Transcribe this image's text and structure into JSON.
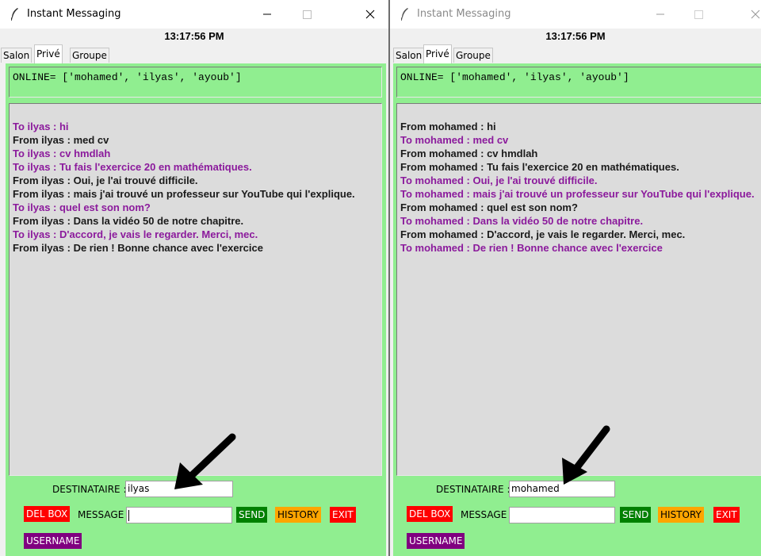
{
  "windows": [
    {
      "title": "Instant Messaging",
      "clock": "13:17:56 PM",
      "tabs": [
        "Salon",
        "Privé",
        "Groupe"
      ],
      "online": "ONLINE= ['mohamed', 'ilyas', 'ayoub']",
      "messages": [
        {
          "dir": "to",
          "text": "To ilyas : hi"
        },
        {
          "dir": "from",
          "text": "From ilyas : med cv"
        },
        {
          "dir": "to",
          "text": "To ilyas : cv hmdlah"
        },
        {
          "dir": "to",
          "text": "To ilyas : Tu fais l'exercice 20 en mathématiques."
        },
        {
          "dir": "from",
          "text": "From ilyas : Oui, je l'ai trouvé difficile."
        },
        {
          "dir": "from",
          "text": "From ilyas : mais j'ai trouvé un professeur sur YouTube qui l'explique."
        },
        {
          "dir": "to",
          "text": "To ilyas : quel est son nom?"
        },
        {
          "dir": "from",
          "text": "From ilyas : Dans la vidéo 50 de notre chapitre."
        },
        {
          "dir": "to",
          "text": "To ilyas : D'accord, je vais le regarder. Merci, mec."
        },
        {
          "dir": "from",
          "text": "From ilyas : De rien ! Bonne chance avec l'exercice"
        }
      ],
      "destinataire_label": "DESTINATAIRE :",
      "destinataire_value": "ilyas",
      "message_label": "MESSAGE :",
      "message_value": "",
      "buttons": {
        "del_box": "DEL BOX",
        "send": "SEND",
        "history": "HISTORY",
        "exit": "EXIT",
        "username": "USERNAME"
      }
    },
    {
      "title": "Instant Messaging",
      "clock": "13:17:56 PM",
      "tabs": [
        "Salon",
        "Privé",
        "Groupe"
      ],
      "online": "ONLINE= ['mohamed', 'ilyas', 'ayoub']",
      "messages": [
        {
          "dir": "from",
          "text": "From mohamed : hi"
        },
        {
          "dir": "to",
          "text": "To mohamed : med cv"
        },
        {
          "dir": "from",
          "text": "From mohamed : cv hmdlah"
        },
        {
          "dir": "from",
          "text": "From mohamed : Tu fais l'exercice 20 en mathématiques."
        },
        {
          "dir": "to",
          "text": "To mohamed : Oui, je l'ai trouvé difficile."
        },
        {
          "dir": "to",
          "text": "To mohamed : mais j'ai trouvé un professeur sur YouTube qui l'explique."
        },
        {
          "dir": "from",
          "text": "From mohamed : quel est son nom?"
        },
        {
          "dir": "to",
          "text": "To mohamed : Dans la vidéo 50 de notre chapitre."
        },
        {
          "dir": "from",
          "text": "From mohamed : D'accord, je vais le regarder. Merci, mec."
        },
        {
          "dir": "to",
          "text": "To mohamed : De rien ! Bonne chance avec l'exercice"
        }
      ],
      "destinataire_label": "DESTINATAIRE :",
      "destinataire_value": "mohamed",
      "message_label": "MESSAGE :",
      "message_value": "",
      "buttons": {
        "del_box": "DEL BOX",
        "send": "SEND",
        "history": "HISTORY",
        "exit": "EXIT",
        "username": "USERNAME"
      }
    }
  ],
  "colors": {
    "panel_bg": "#90ee90",
    "chat_bg": "#dcdcdc",
    "to_text": "#8b1a9c",
    "from_text": "#1a1a1a",
    "red_button": "#ff0000",
    "send_button": "#008000",
    "history_button": "#ffa500",
    "username_button": "#800080"
  },
  "icons": {
    "app": "feather-icon",
    "minimize": "minimize-icon",
    "maximize": "maximize-icon",
    "close": "close-icon",
    "annotation": "arrow-icon"
  }
}
